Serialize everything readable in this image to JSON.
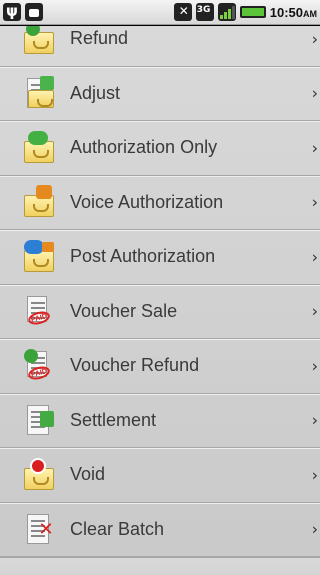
{
  "status_bar": {
    "time": "10:50",
    "ampm": "AM"
  },
  "menu": {
    "items": [
      {
        "label": "Refund",
        "icon": "refund-icon"
      },
      {
        "label": "Adjust",
        "icon": "adjust-icon"
      },
      {
        "label": "Authorization Only",
        "icon": "authorization-only-icon"
      },
      {
        "label": "Voice Authorization",
        "icon": "voice-authorization-icon"
      },
      {
        "label": "Post Authorization",
        "icon": "post-authorization-icon"
      },
      {
        "label": "Voucher Sale",
        "icon": "voucher-sale-icon"
      },
      {
        "label": "Voucher Refund",
        "icon": "voucher-refund-icon"
      },
      {
        "label": "Settlement",
        "icon": "settlement-icon"
      },
      {
        "label": "Void",
        "icon": "void-icon"
      },
      {
        "label": "Clear Batch",
        "icon": "clear-batch-icon"
      }
    ],
    "chevron": "›"
  }
}
